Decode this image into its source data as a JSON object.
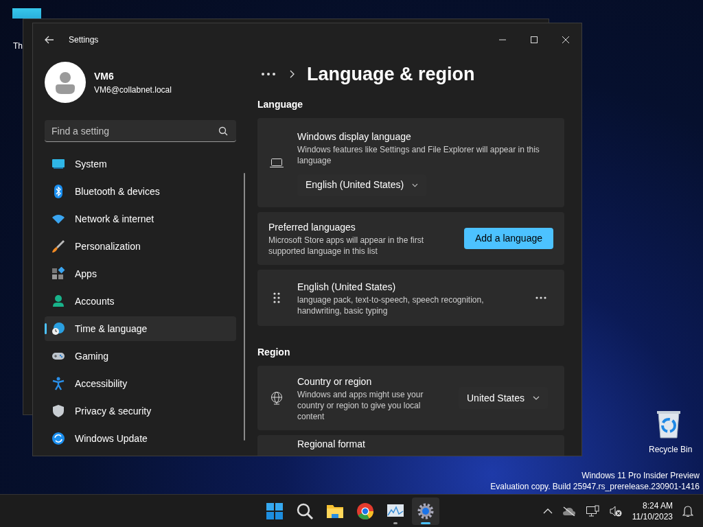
{
  "desktop": {
    "icons": [
      {
        "label": "Th"
      },
      {
        "label": "Recycle Bin"
      }
    ],
    "watermark": [
      "Windows 11 Pro Insider Preview",
      "Evaluation copy. Build 25947.rs_prerelease.230901-1416"
    ]
  },
  "window": {
    "title": "Settings"
  },
  "profile": {
    "name": "VM6",
    "email": "VM6@collabnet.local"
  },
  "search": {
    "placeholder": "Find a setting"
  },
  "sidebar": {
    "items": [
      {
        "label": "System",
        "selected": false
      },
      {
        "label": "Bluetooth & devices",
        "selected": false
      },
      {
        "label": "Network & internet",
        "selected": false
      },
      {
        "label": "Personalization",
        "selected": false
      },
      {
        "label": "Apps",
        "selected": false
      },
      {
        "label": "Accounts",
        "selected": false
      },
      {
        "label": "Time & language",
        "selected": true
      },
      {
        "label": "Gaming",
        "selected": false
      },
      {
        "label": "Accessibility",
        "selected": false
      },
      {
        "label": "Privacy & security",
        "selected": false
      },
      {
        "label": "Windows Update",
        "selected": false
      }
    ]
  },
  "page": {
    "title": "Language & region"
  },
  "sections": [
    {
      "heading": "Language",
      "cards": [
        {
          "kind": "display",
          "title": "Windows display language",
          "description": "Windows features like Settings and File Explorer will appear in this language",
          "dropdown": "English (United States)"
        },
        {
          "kind": "action",
          "title": "Preferred languages",
          "description": "Microsoft Store apps will appear in the first supported language in this list",
          "button": "Add a language"
        },
        {
          "kind": "language",
          "title": "English (United States)",
          "description": "language pack, text-to-speech, speech recognition, handwriting, basic typing"
        }
      ]
    },
    {
      "heading": "Region",
      "cards": [
        {
          "kind": "country",
          "title": "Country or region",
          "description": "Windows and apps might use your country or region to give you local content",
          "dropdown": "United States"
        },
        {
          "kind": "plain",
          "title": "Regional format"
        }
      ]
    }
  ],
  "taskbar": {
    "apps": [
      {
        "selected": false,
        "running": false
      },
      {
        "selected": false,
        "running": false
      },
      {
        "selected": false,
        "running": false
      },
      {
        "selected": false,
        "running": false
      },
      {
        "selected": false,
        "running": true
      },
      {
        "selected": true,
        "running": true
      }
    ],
    "time": "8:24 AM",
    "date": "11/10/2023"
  }
}
